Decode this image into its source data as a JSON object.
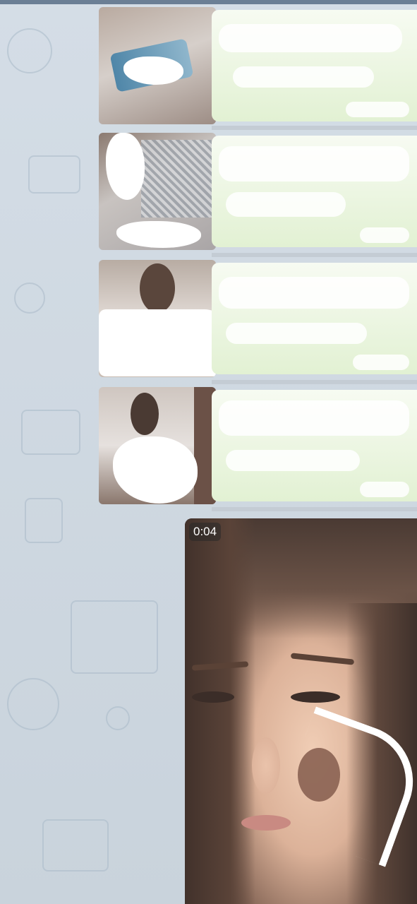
{
  "chat": {
    "photo_messages": [
      {
        "thumbnail": "photo-thumbnail-1"
      },
      {
        "thumbnail": "photo-thumbnail-2"
      },
      {
        "thumbnail": "photo-thumbnail-3"
      },
      {
        "thumbnail": "photo-thumbnail-4"
      }
    ],
    "video_message": {
      "duration": "0:04"
    }
  },
  "colors": {
    "chat_background": "#cfd9e2",
    "bubble": "#e2f1d3",
    "top_bar": "#6b7f95"
  }
}
